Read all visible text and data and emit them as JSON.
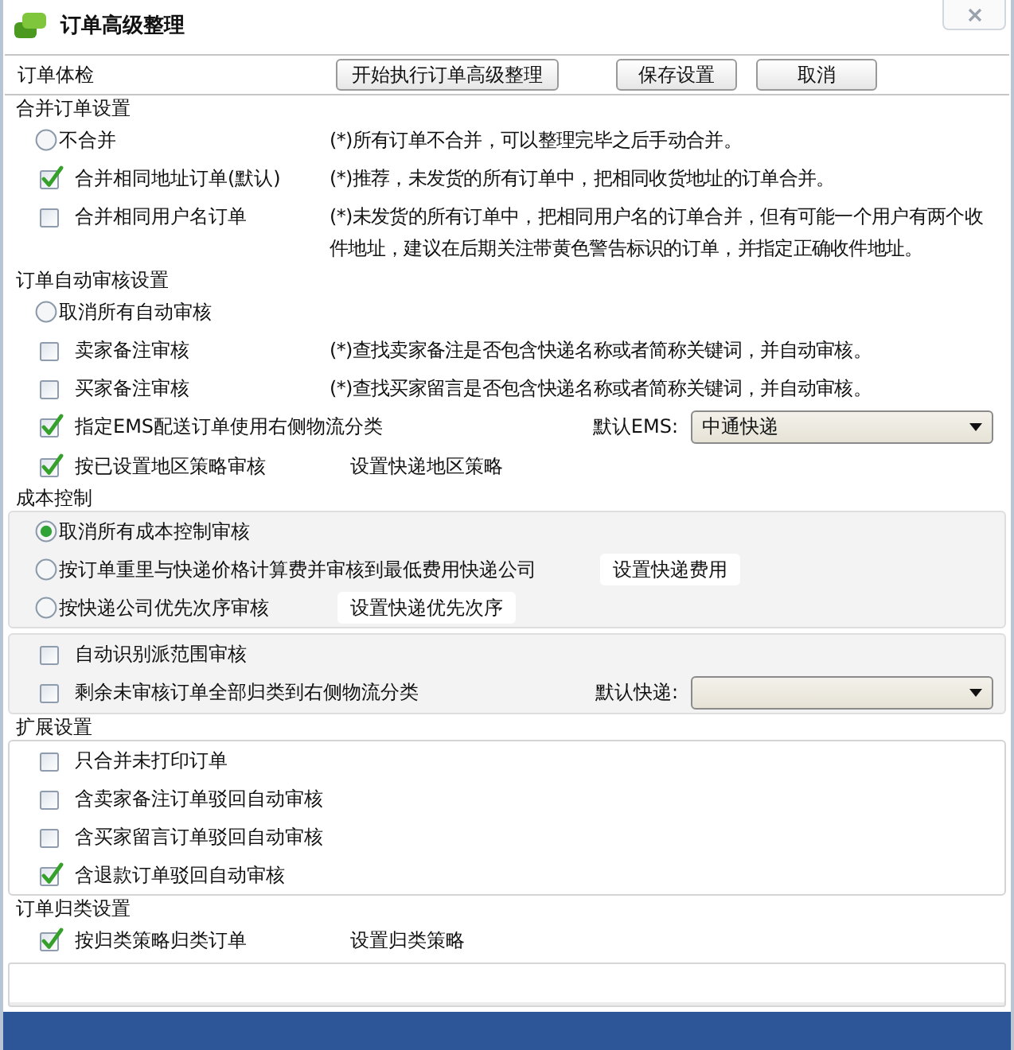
{
  "window": {
    "title": "订单高级整理"
  },
  "toolbar": {
    "label": "订单体检",
    "buttons": [
      "开始执行订单高级整理",
      "保存设置",
      "取消"
    ]
  },
  "sections": [
    {
      "title": "合并订单设置",
      "kind": "plain",
      "items": [
        {
          "kind": "radio",
          "label": "不合并",
          "selected": false,
          "description": "(*)所有订单不合并，可以整理完毕之后手动合并。"
        },
        {
          "kind": "checkbox",
          "label": "合并相同地址订单(默认)",
          "checked": true,
          "description": "(*)推荐，未发货的所有订单中，把相同收货地址的订单合并。"
        },
        {
          "kind": "checkbox",
          "label": "合并相同用户名订单",
          "checked": false,
          "description": "(*)未发货的所有订单中，把相同用户名的订单合并，但有可能一个用户有两个收件地址，建议在后期关注带黄色警告标识的订单，并指定正确收件地址。"
        }
      ]
    },
    {
      "title": "订单自动审核设置",
      "kind": "plain",
      "items": [
        {
          "kind": "radio",
          "label": "取消所有自动审核",
          "selected": false
        },
        {
          "kind": "checkbox",
          "label": "卖家备注审核",
          "checked": false,
          "description": "(*)查找卖家备注是否包含快递名称或者简称关键词，并自动审核。"
        },
        {
          "kind": "checkbox",
          "label": "买家备注审核",
          "checked": false,
          "description": "(*)查找买家留言是否包含快递名称或者简称关键词，并自动审核。"
        },
        {
          "kind": "checkbox",
          "label": "指定EMS配送订单使用右侧物流分类",
          "checked": true,
          "select": {
            "label": "默认EMS:",
            "value": "中通快递"
          }
        },
        {
          "kind": "checkbox",
          "label": "按已设置地区策略审核",
          "checked": true,
          "button": "设置快递地区策略"
        }
      ]
    },
    {
      "title": "成本控制",
      "kind": "shaded",
      "items": [
        {
          "kind": "radio",
          "label": "取消所有成本控制审核",
          "selected": true
        },
        {
          "kind": "radio",
          "label": "按订单重里与快递价格计算费并审核到最低费用快递公司",
          "selected": false,
          "button": "设置快递费用"
        },
        {
          "kind": "radio",
          "label": "按快递公司优先次序审核",
          "selected": false,
          "button": "设置快递优先次序"
        }
      ]
    },
    {
      "kind": "shaded",
      "items": [
        {
          "kind": "checkbox",
          "label": "自动识别派范围审核",
          "checked": false
        },
        {
          "kind": "checkbox",
          "label": "剩余未审核订单全部归类到右侧物流分类",
          "checked": false,
          "select": {
            "label": "默认快递:"
          }
        }
      ]
    },
    {
      "title": "扩展设置",
      "kind": "boxed",
      "items": [
        {
          "kind": "checkbox",
          "label": "只合并未打印订单",
          "checked": false
        },
        {
          "kind": "checkbox",
          "label": "含卖家备注订单驳回自动审核",
          "checked": false
        },
        {
          "kind": "checkbox",
          "label": "含买家留言订单驳回自动审核",
          "checked": false
        },
        {
          "kind": "checkbox",
          "label": "含退款订单驳回自动审核",
          "checked": true
        }
      ]
    },
    {
      "title": "订单归类设置",
      "kind": "plain",
      "items": [
        {
          "kind": "checkbox",
          "label": "按归类策略归类订单",
          "checked": true,
          "button": "设置归类策略"
        }
      ]
    }
  ]
}
